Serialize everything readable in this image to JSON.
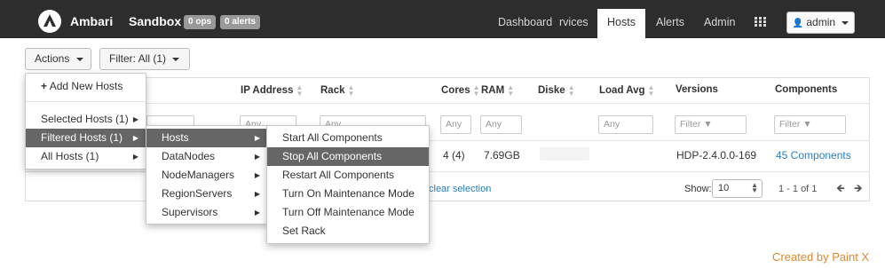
{
  "navbar": {
    "brand": "Ambari",
    "cluster": "Sandbox",
    "ops_badge": "0 ops",
    "alerts_badge": "0 alerts",
    "items": [
      "Dashboard",
      "rvices",
      "Hosts",
      "Alerts",
      "Admin"
    ],
    "active_item": "Hosts",
    "user": "admin"
  },
  "toolbar": {
    "actions_label": "Actions",
    "filter_label": "Filter:",
    "filter_value": "All (1)"
  },
  "table": {
    "columns": [
      "IP Address",
      "Rack",
      "Cores",
      "RAM",
      "Diske",
      "Load Avg",
      "Versions",
      "Components"
    ],
    "filter_placeholders": {
      "ip": "Any",
      "rack": "Any",
      "cores": "Any",
      "ram": "Any",
      "load": "Any",
      "versions": "Filter",
      "components": "Filter"
    },
    "row": {
      "cores": "4 (4)",
      "ram": "7.69GB",
      "version": "HDP-2.4.0.0-169",
      "components": "45 Components"
    },
    "footer": {
      "clear_selection": "clear selection",
      "show_label": "Show:",
      "page_size": "10",
      "page_info": "1 - 1 of 1"
    }
  },
  "menu_actions": {
    "add_new_hosts": "Add New Hosts",
    "items": [
      "Selected Hosts (1)",
      "Filtered Hosts (1)",
      "All Hosts (1)"
    ],
    "active": "Filtered Hosts (1)"
  },
  "menu_filtered": {
    "items": [
      "Hosts",
      "DataNodes",
      "NodeManagers",
      "RegionServers",
      "Supervisors"
    ],
    "active": "Hosts"
  },
  "menu_hosts": {
    "items": [
      "Start All Components",
      "Stop All Components",
      "Restart All Components",
      "Turn On Maintenance Mode",
      "Turn Off Maintenance Mode",
      "Set Rack"
    ],
    "active": "Stop All Components"
  },
  "watermark": "Created by Paint X",
  "colors": {
    "navbar": "#2d2d2d",
    "link": "#2a7fc0",
    "menu_active": "#666666",
    "watermark": "#e0872b"
  },
  "icons": [
    "ambari-logo-icon",
    "grid-icon",
    "user-icon",
    "caret-down-icon",
    "sort-icon",
    "filter-icon",
    "chevron-right-icon",
    "arrow-left-icon",
    "arrow-right-icon"
  ]
}
